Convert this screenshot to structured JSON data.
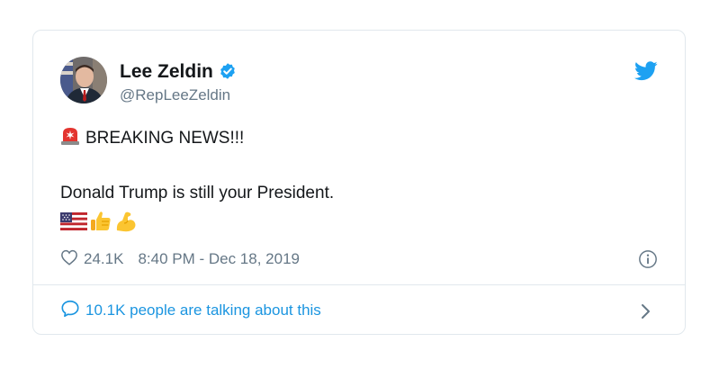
{
  "tweet": {
    "author_name": "Lee Zeldin",
    "handle": "@RepLeeZeldin",
    "line1": "BREAKING NEWS!!!",
    "line2": "Donald Trump is still your President.",
    "likes": "24.1K",
    "timestamp": "8:40 PM - Dec 18, 2019",
    "talking": "10.1K people are talking about this"
  },
  "icons": {
    "brand": "twitter-bird-icon",
    "verified": "verified-badge-icon",
    "siren": "siren-emoji",
    "flag": "us-flag-emoji",
    "thumbs": "thumbs-up-emoji",
    "muscle": "flexed-biceps-emoji",
    "like": "heart-outline-icon",
    "info": "info-circle-icon",
    "reply": "speech-bubble-icon",
    "chevron": "chevron-right-icon"
  },
  "colors": {
    "twitter_blue": "#1da1f2",
    "link_blue": "#1b95e0",
    "text": "#14171a",
    "muted": "#657786",
    "border": "#e1e8ed"
  }
}
